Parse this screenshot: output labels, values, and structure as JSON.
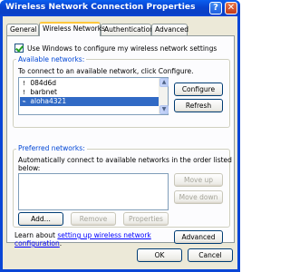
{
  "window": {
    "title": "Wireless Network Connection Properties",
    "help_label": "?",
    "close_label": "✕"
  },
  "tabs": [
    {
      "label": "General"
    },
    {
      "label": "Wireless Networks"
    },
    {
      "label": "Authentication"
    },
    {
      "label": "Advanced"
    }
  ],
  "use_windows": {
    "label": "Use Windows to configure my wireless network settings",
    "checked": true
  },
  "available": {
    "title": "Available networks:",
    "instruction": "To connect to an available network, click Configure.",
    "networks": [
      {
        "name": "084d6d",
        "icon": "antenna-icon",
        "selected": false
      },
      {
        "name": "barbnet",
        "icon": "antenna-icon",
        "selected": false
      },
      {
        "name": "aloha4321",
        "icon": "wifi-signal-icon",
        "selected": true
      }
    ],
    "configure_label": "Configure",
    "refresh_label": "Refresh"
  },
  "preferred": {
    "title": "Preferred networks:",
    "instruction_line1": "Automatically connect to available networks in the order listed",
    "instruction_line2": "below:",
    "move_up_label": "Move up",
    "move_down_label": "Move down",
    "add_label": "Add...",
    "remove_label": "Remove",
    "properties_label": "Properties"
  },
  "learn": {
    "prefix": "Learn about ",
    "link_text_line1": "setting up wireless network",
    "link_text_line2": "configuration",
    "suffix": ".",
    "advanced_label": "Advanced"
  },
  "footer": {
    "ok_label": "OK",
    "cancel_label": "Cancel"
  }
}
